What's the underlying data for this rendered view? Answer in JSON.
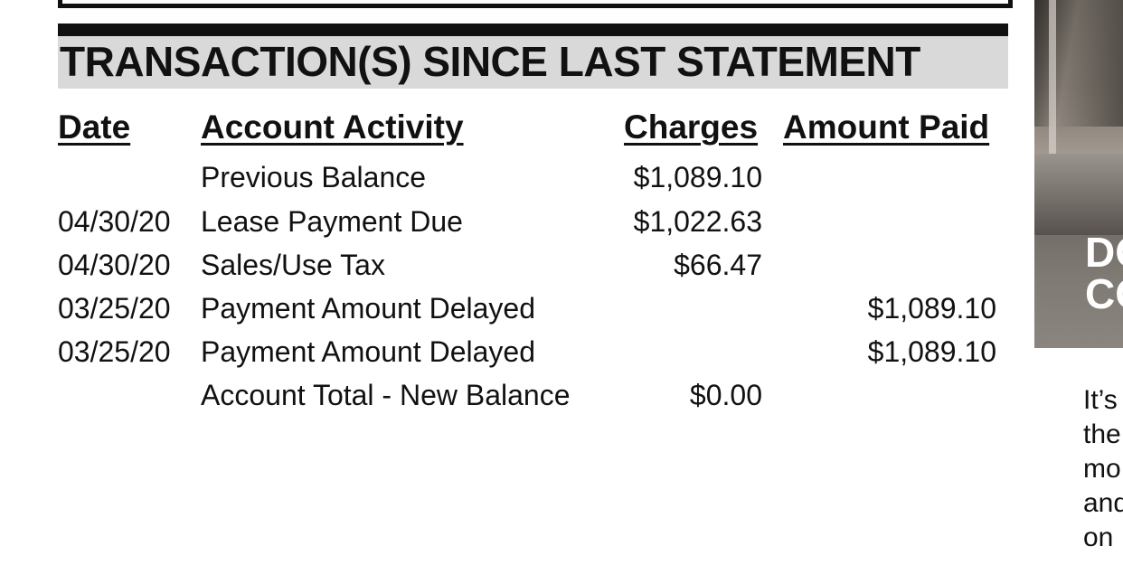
{
  "section": {
    "title": "TRANSACTION(S) SINCE LAST STATEMENT"
  },
  "columns": {
    "date": "Date",
    "activity": "Account Activity",
    "charges": "Charges",
    "paid": "Amount Paid"
  },
  "rows": [
    {
      "date": "",
      "activity": "Previous Balance",
      "charges": "$1,089.10",
      "paid": ""
    },
    {
      "date": "04/30/20",
      "activity": "Lease Payment Due",
      "charges": "$1,022.63",
      "paid": ""
    },
    {
      "date": "04/30/20",
      "activity": "Sales/Use Tax",
      "charges": "$66.47",
      "paid": ""
    },
    {
      "date": "03/25/20",
      "activity": "Payment Amount Delayed",
      "charges": "",
      "paid": "$1,089.10"
    },
    {
      "date": "03/25/20",
      "activity": "Payment Amount Delayed",
      "charges": "",
      "paid": "$1,089.10"
    },
    {
      "date": "",
      "activity": "Account Total - New Balance",
      "charges": "$0.00",
      "paid": ""
    }
  ],
  "side_panel": {
    "image_text_line1": "DO",
    "image_text_line2": "CO",
    "body_lines": [
      "It’s",
      "the",
      "mo",
      "and",
      "on"
    ]
  }
}
